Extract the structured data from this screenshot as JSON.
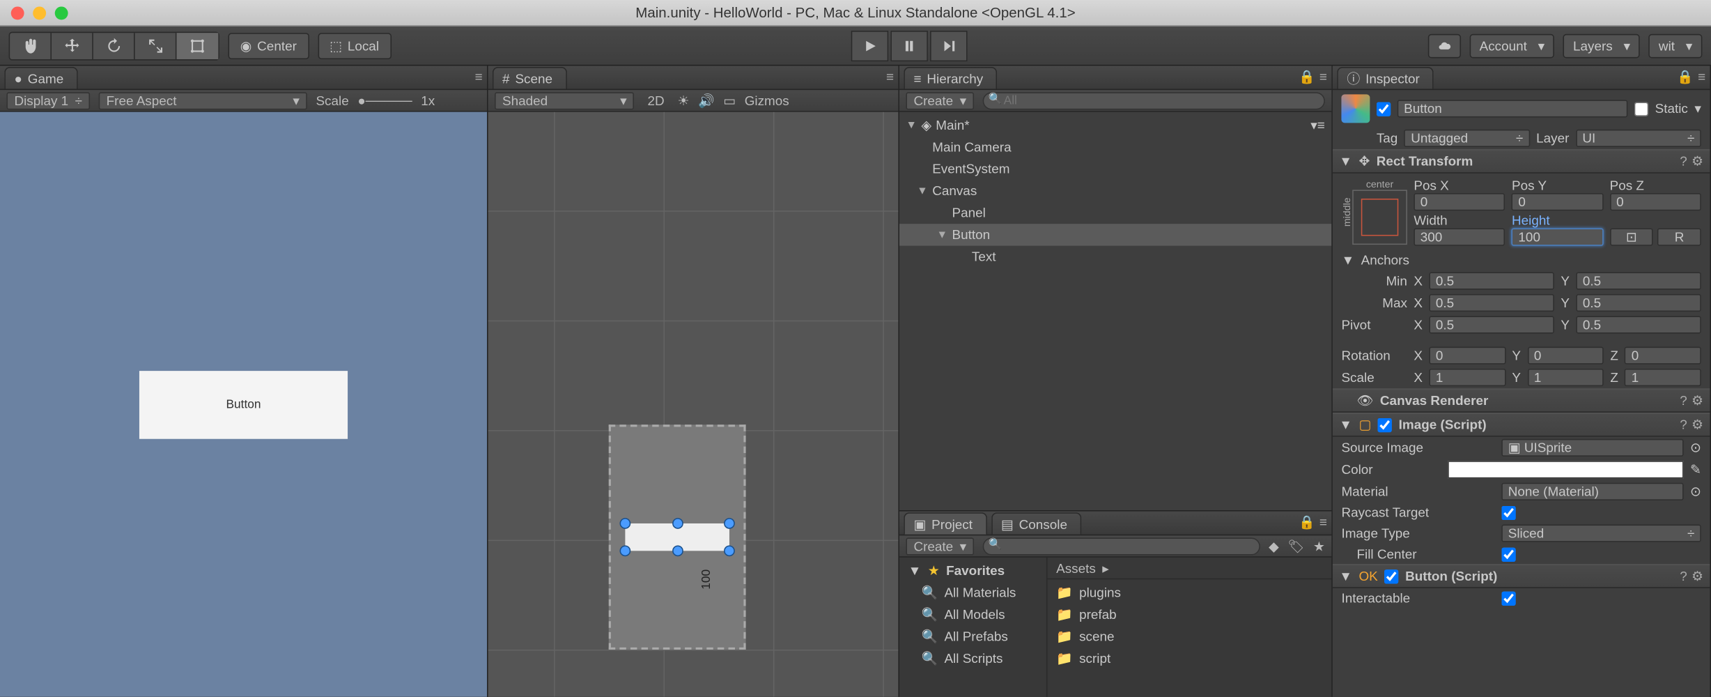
{
  "window_title": "Main.unity - HelloWorld - PC, Mac & Linux Standalone <OpenGL 4.1>",
  "toolbar": {
    "pivot": "Center",
    "space": "Local",
    "account": "Account",
    "layers": "Layers",
    "layout": "wit"
  },
  "game": {
    "tab": "Game",
    "display": "Display 1",
    "aspect": "Free Aspect",
    "scale_label": "Scale",
    "scale_value": "1x",
    "button_text": "Button"
  },
  "scene": {
    "tab": "Scene",
    "shading": "Shaded",
    "mode2d": "2D",
    "gizmos": "Gizmos",
    "dim_label": "100"
  },
  "hierarchy": {
    "tab": "Hierarchy",
    "create": "Create",
    "search_placeholder": "All",
    "items": [
      "Main*",
      "Main Camera",
      "EventSystem",
      "Canvas",
      "Panel",
      "Button",
      "Text"
    ]
  },
  "project": {
    "tab_project": "Project",
    "tab_console": "Console",
    "create": "Create",
    "favorites": "Favorites",
    "fav_items": [
      "All Materials",
      "All Models",
      "All Prefabs",
      "All Scripts"
    ],
    "assets_label": "Assets",
    "assets": [
      "plugins",
      "prefab",
      "scene",
      "script"
    ]
  },
  "inspector": {
    "tab": "Inspector",
    "name": "Button",
    "static": "Static",
    "tag_label": "Tag",
    "tag_value": "Untagged",
    "layer_label": "Layer",
    "layer_value": "UI",
    "rect": {
      "title": "Rect Transform",
      "anchor_preset": "center",
      "middle": "middle",
      "posx_l": "Pos X",
      "posy_l": "Pos Y",
      "posz_l": "Pos Z",
      "posx": "0",
      "posy": "0",
      "posz": "0",
      "width_l": "Width",
      "height_l": "Height",
      "width": "300",
      "height": "100",
      "r_btn": "R",
      "anchors": "Anchors",
      "min": "Min",
      "max": "Max",
      "pivot": "Pivot",
      "min_x": "0.5",
      "min_y": "0.5",
      "max_x": "0.5",
      "max_y": "0.5",
      "pivot_x": "0.5",
      "pivot_y": "0.5",
      "rotation": "Rotation",
      "rot_x": "0",
      "rot_y": "0",
      "rot_z": "0",
      "scale": "Scale",
      "sc_x": "1",
      "sc_y": "1",
      "sc_z": "1",
      "X": "X",
      "Y": "Y",
      "Z": "Z"
    },
    "canvas_renderer": "Canvas Renderer",
    "image": {
      "title": "Image (Script)",
      "source_l": "Source Image",
      "source_v": "UISprite",
      "color_l": "Color",
      "material_l": "Material",
      "material_v": "None (Material)",
      "raycast_l": "Raycast Target",
      "type_l": "Image Type",
      "type_v": "Sliced",
      "fill_l": "Fill Center"
    },
    "button": {
      "title": "Button (Script)",
      "interactable_l": "Interactable"
    }
  }
}
